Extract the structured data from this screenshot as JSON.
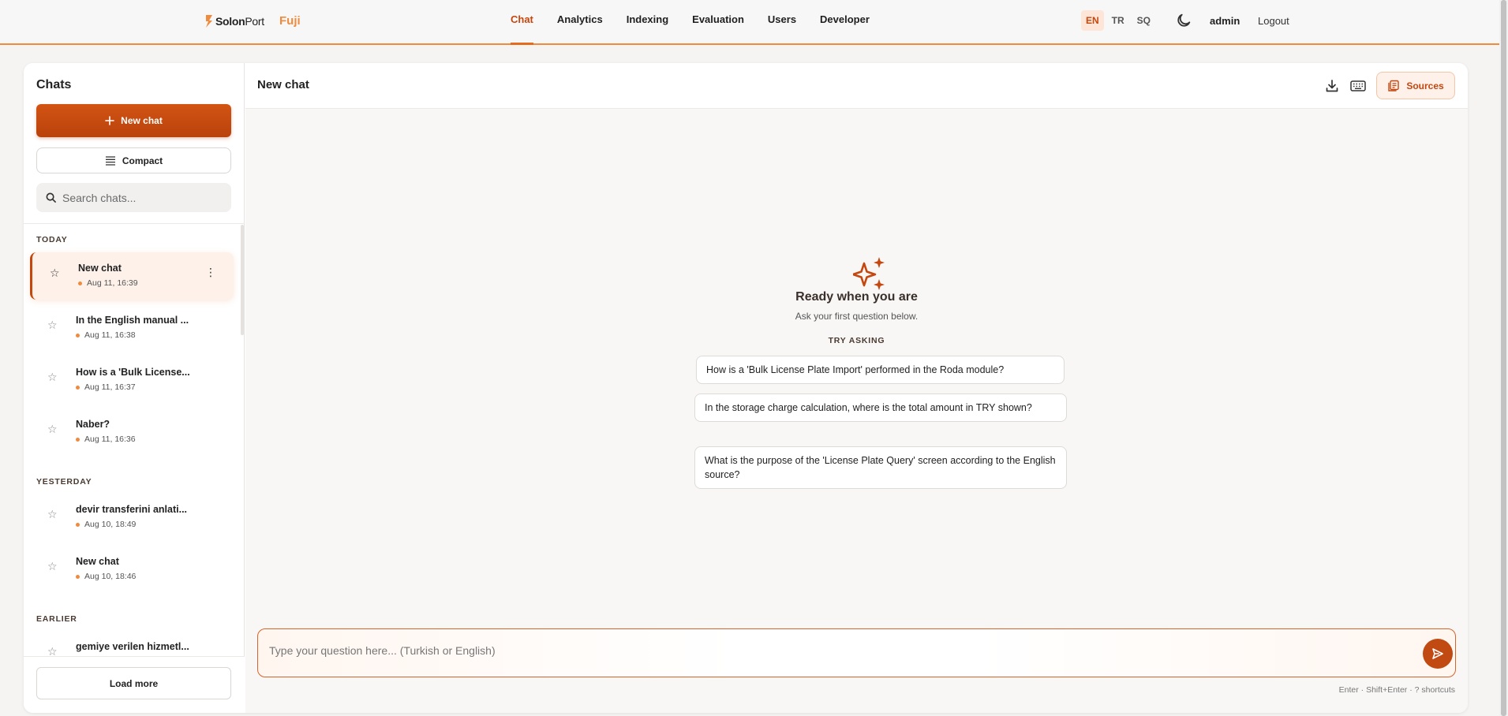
{
  "header": {
    "logo_bold": "Solon",
    "logo_light": "Port",
    "brand_sub": "Fuji",
    "nav": [
      {
        "label": "Chat",
        "active": true
      },
      {
        "label": "Analytics"
      },
      {
        "label": "Indexing"
      },
      {
        "label": "Evaluation"
      },
      {
        "label": "Users"
      },
      {
        "label": "Developer"
      }
    ],
    "languages": [
      "EN",
      "TR",
      "SQ"
    ],
    "active_language": "EN",
    "theme_icon": "moon-icon",
    "user": "admin",
    "logout_label": "Logout"
  },
  "sidebar": {
    "title": "Chats",
    "new_chat_label": "New chat",
    "compact_label": "Compact",
    "search_placeholder": "Search chats...",
    "groups": [
      {
        "label": "TODAY"
      },
      {
        "label": "YESTERDAY"
      },
      {
        "label": "EARLIER"
      }
    ],
    "chats": [
      {
        "title": "New chat",
        "date": "Aug 11, 16:39"
      },
      {
        "title": "In the English manual ...",
        "date": "Aug 11, 16:38"
      },
      {
        "title": "How is a 'Bulk License...",
        "date": "Aug 11, 16:37"
      },
      {
        "title": "Naber?",
        "date": "Aug 11, 16:36"
      },
      {
        "title": "devir transferini anlati...",
        "date": "Aug 10, 18:49"
      },
      {
        "title": "New chat",
        "date": "Aug 10, 18:46"
      },
      {
        "title": "gemiye verilen hizmetl..."
      }
    ],
    "load_more_label": "Load more"
  },
  "main": {
    "title": "New chat",
    "sources_label": "Sources",
    "empty_title": "Ready when you are",
    "empty_subtitle": "Ask your first question below.",
    "try_label": "TRY ASKING",
    "suggestions": [
      "How is a 'Bulk License Plate Import' performed in the Roda module?",
      "In the storage charge calculation, where is the total amount in TRY shown?",
      "What is the purpose of the 'License Plate Query' screen according to the English source?"
    ],
    "composer_placeholder": "Type your question here... (Turkish or English)",
    "shortcut_hint": "Enter · Shift+Enter · ? shortcuts"
  },
  "colors": {
    "accent": "#c4470f",
    "accent_light": "#f08a3c",
    "accent_bg": "#fdf1ea"
  }
}
